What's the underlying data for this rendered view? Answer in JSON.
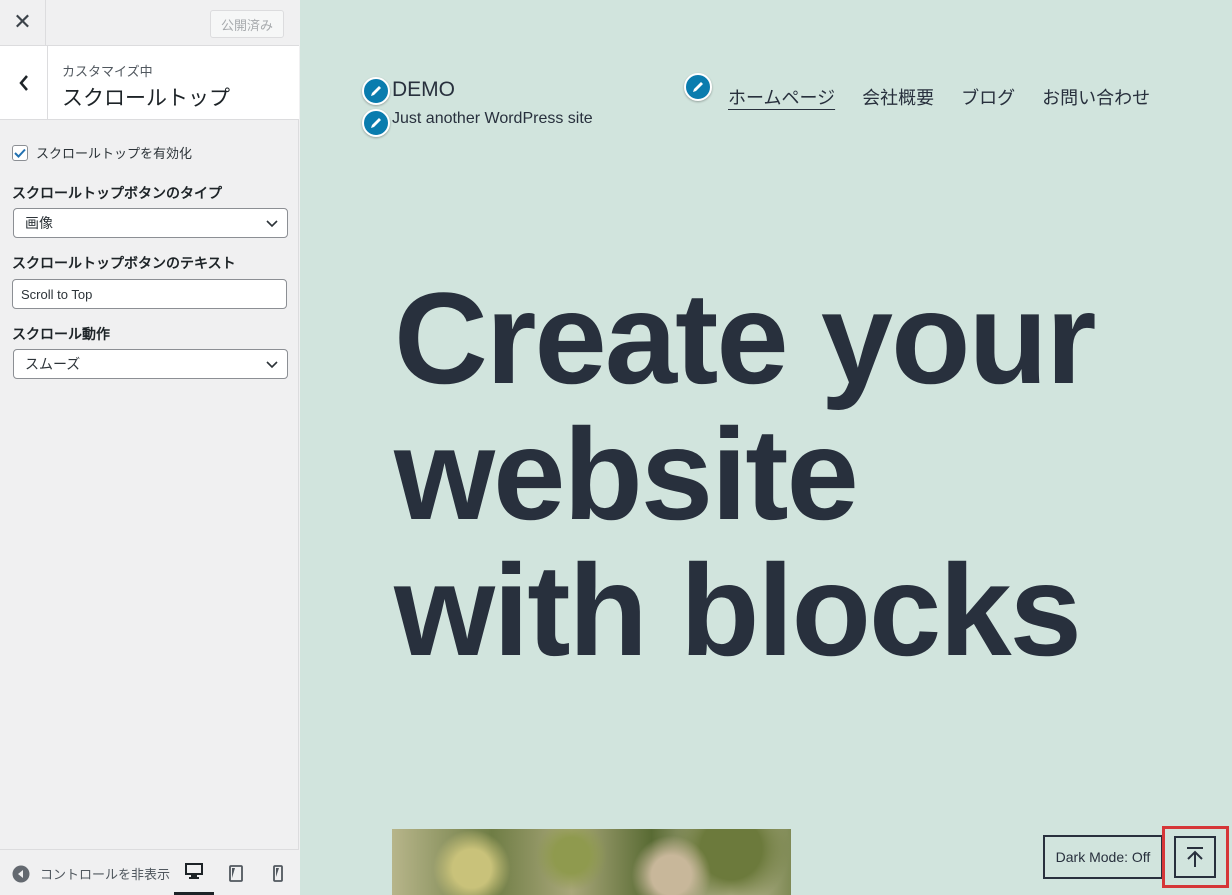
{
  "sidebar": {
    "close_icon": "close-icon",
    "publish_label": "公開済み",
    "section": {
      "subtitle": "カスタマイズ中",
      "title": "スクロールトップ"
    },
    "controls": {
      "enable_label": "スクロールトップを有効化",
      "enable_checked": true,
      "button_type_label": "スクロールトップボタンのタイプ",
      "button_type_value": "画像",
      "button_text_label": "スクロールトップボタンのテキスト",
      "button_text_value": "Scroll to Top",
      "behavior_label": "スクロール動作",
      "behavior_value": "スムーズ"
    },
    "footer": {
      "hide_controls_label": "コントロールを非表示",
      "devices": [
        "desktop-icon",
        "tablet-icon",
        "mobile-icon"
      ],
      "active_device": "desktop"
    }
  },
  "preview": {
    "site_title": "DEMO",
    "tagline": "Just another WordPress site",
    "nav": [
      "ホームページ",
      "会社概要",
      "ブログ",
      "お問い合わせ"
    ],
    "hero_lines": [
      "Create your",
      "website",
      "with blocks"
    ],
    "dark_mode_label": "Dark Mode: Off",
    "scroll_top_icon": "arrow-up-to-line-icon",
    "background_color": "#d1e4dd",
    "text_color": "#28303d",
    "edit_shortcut_color": "#0a7cae",
    "highlight_color": "#d63638"
  }
}
